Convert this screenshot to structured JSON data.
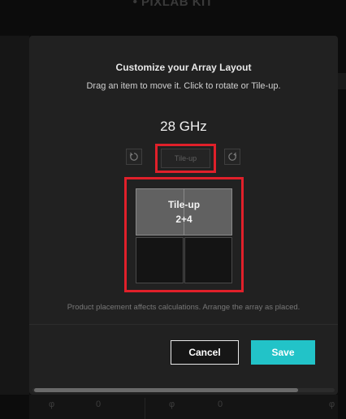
{
  "background": {
    "app_title": "• PIXLAB KIT",
    "bottom_cells": [
      "φ",
      "0",
      "φ",
      "0",
      "φ"
    ]
  },
  "modal": {
    "title": "Customize your Array Layout",
    "subtitle": "Drag an item to move it. Click to rotate or Tile-up.",
    "frequency": "28 GHz",
    "toolbar": {
      "rotate_left_icon": "rotate-left-icon",
      "rotate_right_icon": "rotate-right-icon",
      "tileup_label": "Tile-up"
    },
    "array": {
      "tile_label_line1": "Tile-up",
      "tile_label_line2": "2+4",
      "empty_cells": 2
    },
    "note": "Product placement affects calculations. Arrange the array as placed.",
    "cancel_label": "Cancel",
    "save_label": "Save"
  },
  "colors": {
    "highlight": "#e0202a",
    "save": "#22c3c8",
    "modal_bg": "#212121"
  }
}
